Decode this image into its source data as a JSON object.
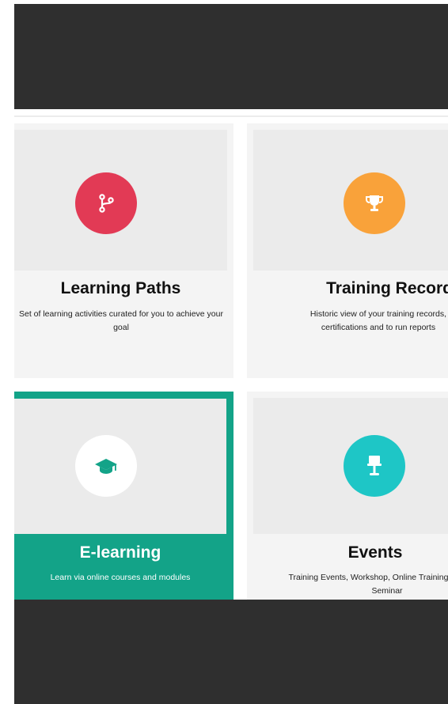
{
  "cards": [
    {
      "title": "Learning Paths",
      "description": "Set of learning activities curated for you to achieve your goal",
      "icon": "branch-icon",
      "icon_color": "#e23a55"
    },
    {
      "title": "Training Record",
      "description": "Historic view of your training records, certifications and to run reports",
      "icon": "trophy-icon",
      "icon_color": "#f9a23a"
    },
    {
      "title": "E-learning",
      "description": "Learn via online courses and modules",
      "icon": "graduation-cap-icon",
      "icon_color": "#13a388"
    },
    {
      "title": "Events",
      "description": "Training Events, Workshop, Online Training, Webinar, Seminar",
      "icon": "presentation-icon",
      "icon_color": "#1ec6c6"
    }
  ],
  "colors": {
    "header_bg": "#2f2f2f",
    "selected_card_bg": "#13a388"
  }
}
